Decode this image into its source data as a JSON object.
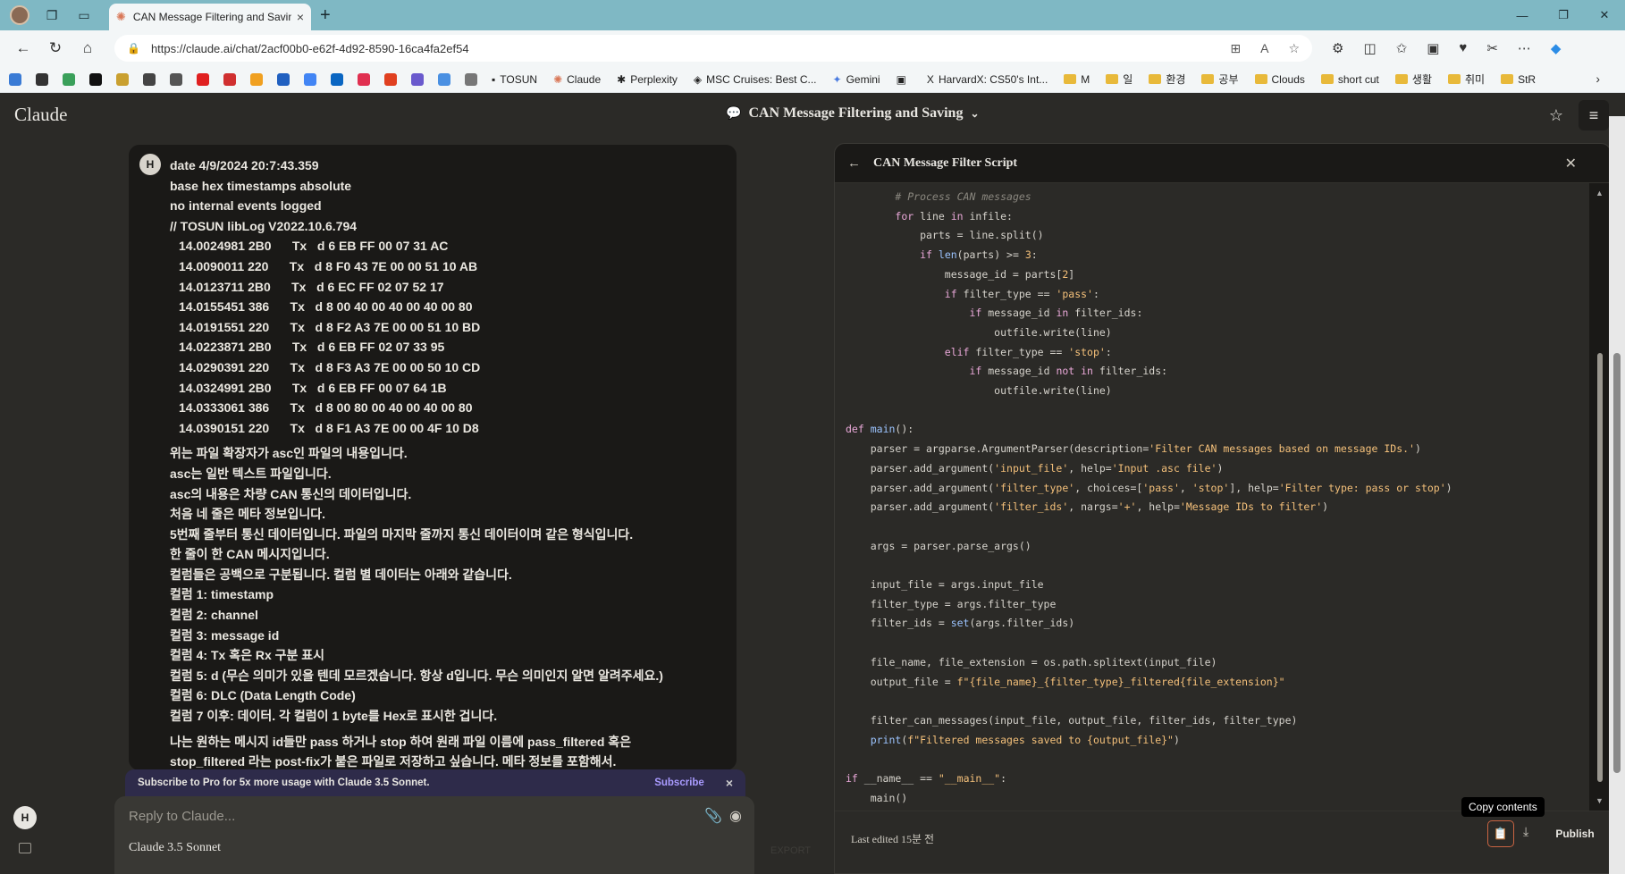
{
  "browser": {
    "tab_title": "CAN Message Filtering and Saving",
    "tab_close": "×",
    "new_tab": "+",
    "url": "https://claude.ai/chat/2acf00b0-e62f-4d92-8590-16ca4fa2ef54",
    "bookmarks": [
      "TOSUN",
      "Claude",
      "Perplexity",
      "MSC Cruises: Best C...",
      "Gemini",
      "HarvardX: CS50's Int..."
    ],
    "folders": [
      "M",
      "일",
      "환경",
      "공부",
      "Clouds",
      "short cut",
      "생활",
      "취미",
      "StR"
    ]
  },
  "app": {
    "brand": "Claude",
    "chat_title": "CAN Message Filtering and Saving",
    "user_initial": "H"
  },
  "message": {
    "header_lines": [
      "date 4/9/2024 20:7:43.359",
      "base hex  timestamps absolute",
      "no internal events logged",
      "// TOSUN libLog V2022.10.6.794"
    ],
    "data_lines": [
      "14.0024981 2B0      Tx   d 6 EB FF 00 07 31 AC",
      "14.0090011 220      Tx   d 8 F0 43 7E 00 00 51 10 AB",
      "14.0123711 2B0      Tx   d 6 EC FF 02 07 52 17",
      "14.0155451 386      Tx   d 8 00 40 00 40 00 40 00 80",
      "14.0191551 220      Tx   d 8 F2 A3 7E 00 00 51 10 BD",
      "14.0223871 2B0      Tx   d 6 EB FF 02 07 33 95",
      "14.0290391 220      Tx   d 8 F3 A3 7E 00 00 50 10 CD",
      "14.0324991 2B0      Tx   d 6 EB FF 00 07 64 1B",
      "14.0333061 386      Tx   d 8 00 80 00 40 00 40 00 80",
      "14.0390151 220      Tx   d 8 F1 A3 7E 00 00 4F 10 D8"
    ],
    "desc_lines": [
      "위는 파일 확장자가 asc인 파일의 내용입니다.",
      "asc는 일반 텍스트 파일입니다.",
      "asc의 내용은 차량 CAN 통신의 데이터입니다.",
      "처음 네 줄은 메타 정보입니다.",
      "5번째 줄부터 통신 데이터입니다. 파일의 마지막 줄까지 통신 데이터이며 같은 형식입니다.",
      "한 줄이 한 CAN 메시지입니다.",
      "컬럼들은 공백으로 구분됩니다. 컬럼 별 데이터는 아래와 같습니다.",
      "컬럼 1: timestamp",
      "컬럼 2: channel",
      "컬럼 3: message id",
      "컬럼 4: Tx 혹은 Rx 구분 표시",
      "컬럼 5: d (무슨 의미가 있을 텐데 모르겠습니다. 항상 d입니다. 무슨 의미인지 알면 알려주세요.)",
      "컬럼 6: DLC (Data Length Code)",
      "컬럼 7 이후: 데이터. 각 컬럼이 1 byte를 Hex로 표시한 겁니다."
    ],
    "request_lines": [
      "나는 원하는 메시지 id들만 pass 하거나 stop 하여 원래 파일 이름에 pass_filtered 혹은",
      "stop_filtered 라는 post-fix가 붙은 파일로 저장하고 싶습니다. 메타 정보를 포함해서."
    ]
  },
  "subscribe": {
    "text": "Subscribe to Pro for 5x more usage with Claude 3.5 Sonnet.",
    "button": "Subscribe",
    "close": "×"
  },
  "input": {
    "placeholder": "Reply to Claude...",
    "model": "Claude 3.5 Sonnet"
  },
  "ghost": "EXPORT",
  "artifact": {
    "title": "CAN Message Filter Script",
    "last_edited": "Last edited 15분 전",
    "publish": "Publish",
    "tooltip": "Copy contents"
  }
}
